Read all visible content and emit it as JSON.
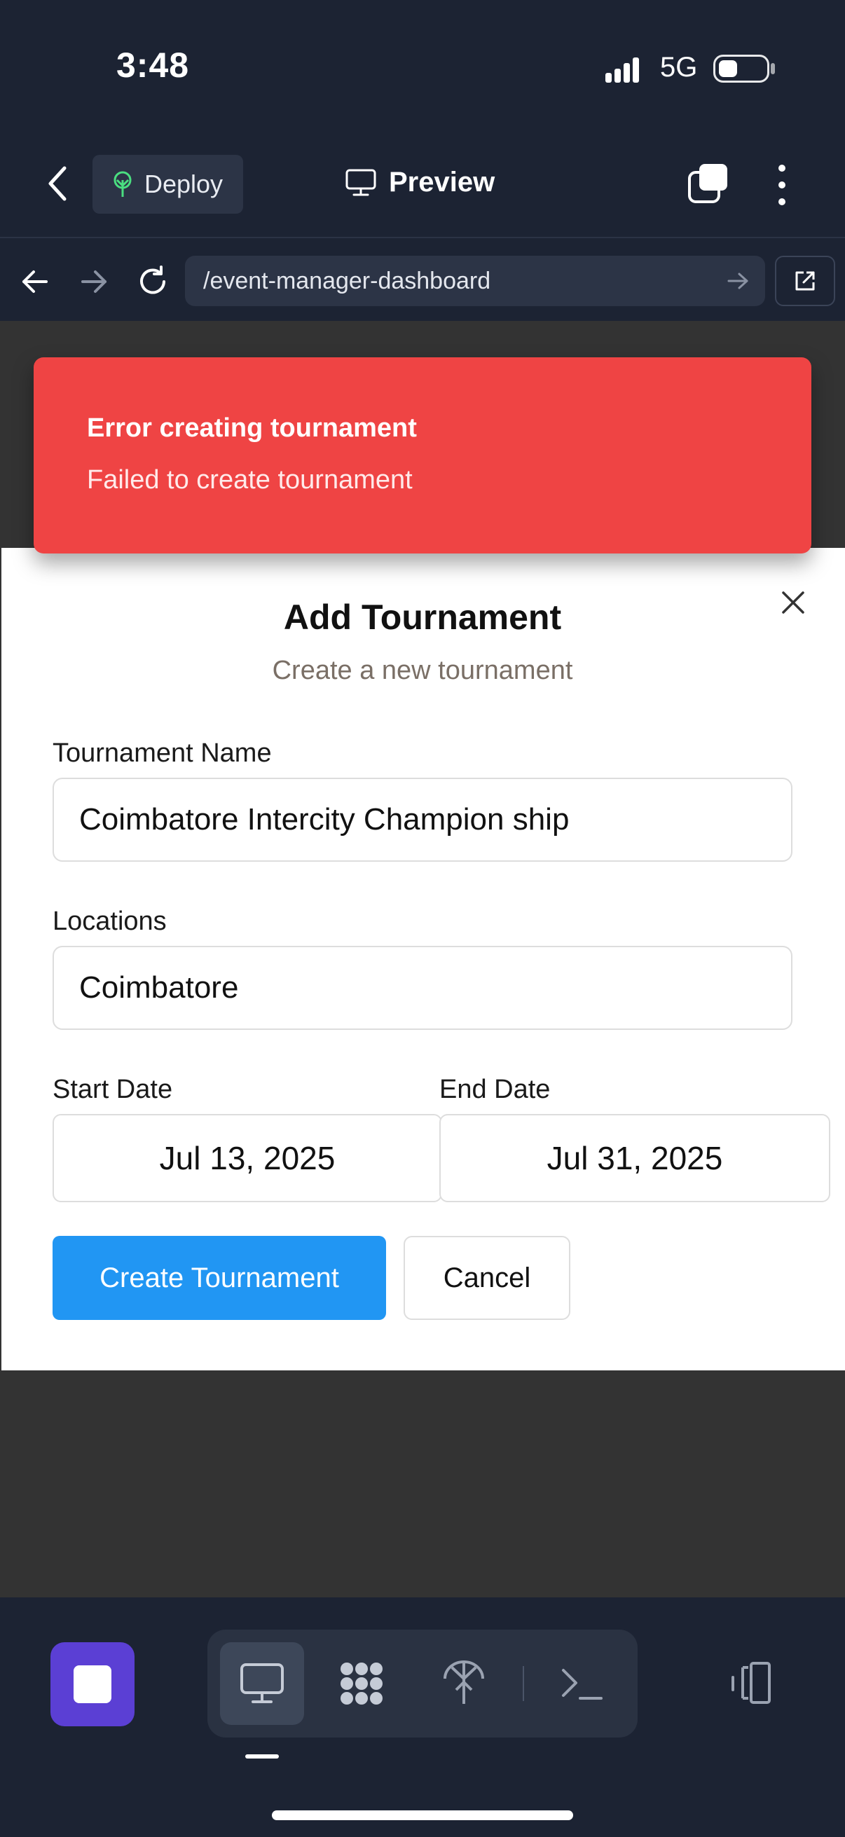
{
  "status_bar": {
    "time": "3:48",
    "network": "5G",
    "icons": [
      "signal-icon",
      "battery-icon"
    ]
  },
  "app_header": {
    "deploy_label": "Deploy",
    "preview_label": "Preview",
    "icons": [
      "back-chevron-icon",
      "deploy-icon",
      "monitor-icon",
      "tabs-icon",
      "more-vertical-icon"
    ]
  },
  "browser_bar": {
    "url": "/event-manager-dashboard",
    "icons": [
      "nav-back-icon",
      "nav-forward-icon",
      "reload-icon",
      "go-arrow-icon",
      "open-external-icon"
    ]
  },
  "toast": {
    "title": "Error creating tournament",
    "message": "Failed to create tournament",
    "color": "#ef4444"
  },
  "modal": {
    "title": "Add Tournament",
    "subtitle": "Create a new tournament",
    "fields": {
      "name_label": "Tournament Name",
      "name_value": "Coimbatore Intercity Champion ship",
      "locations_label": "Locations",
      "locations_value": "Coimbatore",
      "start_label": "Start Date",
      "start_value": "Jul 13, 2025",
      "end_label": "End Date",
      "end_value": "Jul 31, 2025"
    },
    "create_button": "Create Tournament",
    "cancel_button": "Cancel",
    "accent": "#2196f3"
  },
  "bottom_toolbar": {
    "stop_color": "#5b3fd4",
    "tools": [
      "preview-monitor-icon",
      "apps-grid-icon",
      "deploy-tree-icon",
      "terminal-icon"
    ],
    "side_icon": "split-view-icon"
  }
}
